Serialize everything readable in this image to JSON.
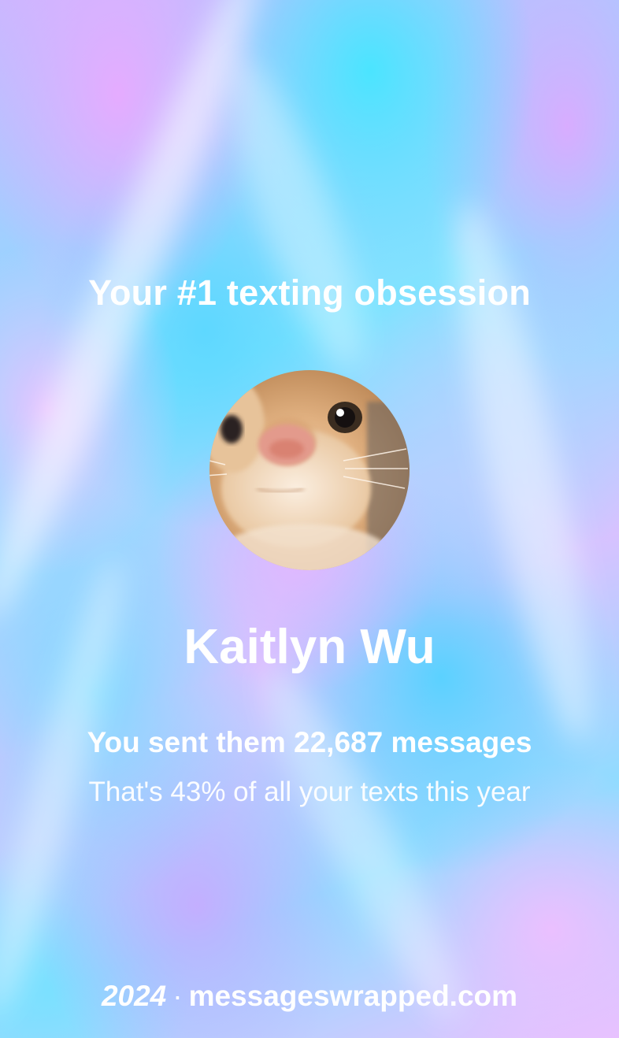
{
  "headline": "Your #1 texting obsession",
  "avatar_icon": "cat-photo-avatar",
  "contact": {
    "name": "Kaitlyn Wu"
  },
  "stats": {
    "sent_line": "You sent them 22,687 messages",
    "share_line": "That's 43% of all your texts this year"
  },
  "footer": {
    "year": "2024",
    "separator": "·",
    "site": "messageswrapped.com"
  }
}
